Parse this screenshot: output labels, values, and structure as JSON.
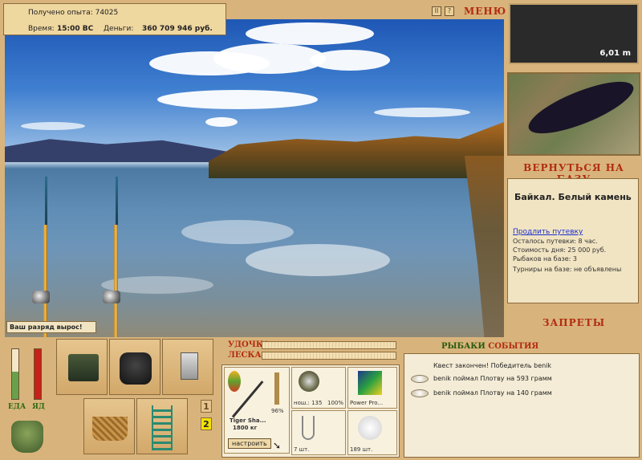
{
  "top_info": {
    "experience_label": "Получено опыта: 74025",
    "time_label": "Время:",
    "time_value": "15:00 ВС",
    "money_label": "Деньги:",
    "money_value": "360 709 946 руб."
  },
  "top_bar": {
    "pause_label": "II",
    "help_label": "?",
    "menu_label": "МЕНЮ"
  },
  "depth_readout": "6,01 m",
  "base_button": "ВЕРНУТЬСЯ НА БАЗУ",
  "location": {
    "title": "Байкал. Белый камень",
    "extend_link": "Продлить путевку",
    "lines": [
      "Осталось путевки: 8 час.",
      "Стоимость дня: 25 000 руб.",
      "Рыбаков на базе: 3",
      "Турниры на базе: не объявлены"
    ]
  },
  "bans_button": "ЗАПРЕТЫ",
  "rank_notice": "Ваш разряд вырос!",
  "status_bars": {
    "food_label": "ЕДА",
    "health_label": "ЯД",
    "food_level": 0.55,
    "health_level": 1.0,
    "colors": {
      "food": "#6aa04a",
      "health": "#c42218"
    }
  },
  "rod_panel": {
    "rod_label": "УДОЧКА",
    "line_label": "ЛЕСКА",
    "rod_name": "Tiger Sha...",
    "rod_weight": "1800 кг",
    "rod_wear": "96%",
    "setup_button": "настроить",
    "reel_label": "нош.: 135",
    "reel_wear": "100%",
    "line_name": "Power Pro...",
    "hooks_count": "7 шт.",
    "bait_count": "189 шт."
  },
  "slot_numbers": [
    "1",
    "2"
  ],
  "log": {
    "title_part1": "РЫБАКИ",
    "title_part2": "СОБЫТИЯ",
    "lines": [
      "Квест закончен! Победитель benik",
      "benik поймал Плотву на 593 грамм",
      "benik поймал Плотву на 140 грамм"
    ]
  }
}
